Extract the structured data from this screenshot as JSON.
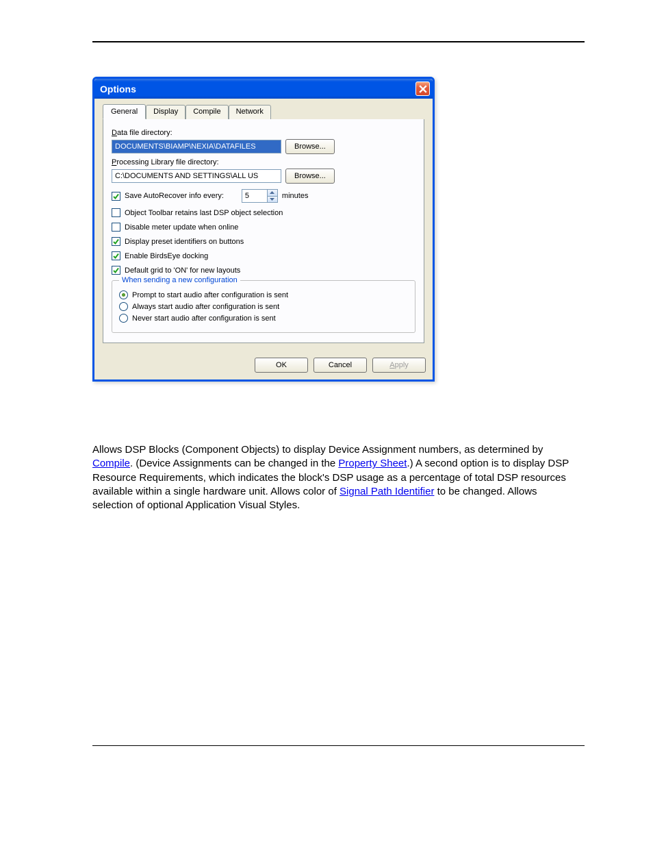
{
  "dialog": {
    "title": "Options",
    "tabs": [
      "General",
      "Display",
      "Compile",
      "Network"
    ],
    "active_tab": 0,
    "data_file_label": "Data file directory:",
    "data_file_value": "DOCUMENTS\\BIAMP\\NEXIA\\DATAFILES",
    "browse_label": "Browse...",
    "lib_dir_label": "Processing Library file directory:",
    "lib_dir_value": "C:\\DOCUMENTS AND SETTINGS\\ALL US",
    "autorecover_label": "Save AutoRecover info every:",
    "autorecover_value": "5",
    "minutes_label": "minutes",
    "cb_toolbar": "Object Toolbar retains last DSP object selection",
    "cb_meter": "Disable meter update when online",
    "cb_preset": "Display preset identifiers on buttons",
    "cb_birdseye": "Enable BirdsEye docking",
    "cb_grid": "Default grid to 'ON' for new layouts",
    "fieldset_legend": "When sending a new configuration",
    "radio_prompt": "Prompt to start audio after configuration is sent",
    "radio_always": "Always start audio after configuration is sent",
    "radio_never": "Never start audio after configuration is sent",
    "ok_label": "OK",
    "cancel_label": "Cancel",
    "apply_label": "Apply"
  },
  "paragraph": {
    "t1": "Allows DSP Blocks (Component Objects) to display Device Assignment numbers, as determined by ",
    "link1": "Compile",
    "t2": ". (Device Assignments can be changed in the ",
    "link2": "Property Sheet",
    "t3": ".) A second option is to display DSP Resource Requirements, which indicates the block's DSP usage as a percentage of total DSP resources available within a single hardware unit. Allows color of ",
    "link3": "Signal Path Identifier",
    "t4": " to be changed. Allows selection of optional Application Visual Styles."
  }
}
